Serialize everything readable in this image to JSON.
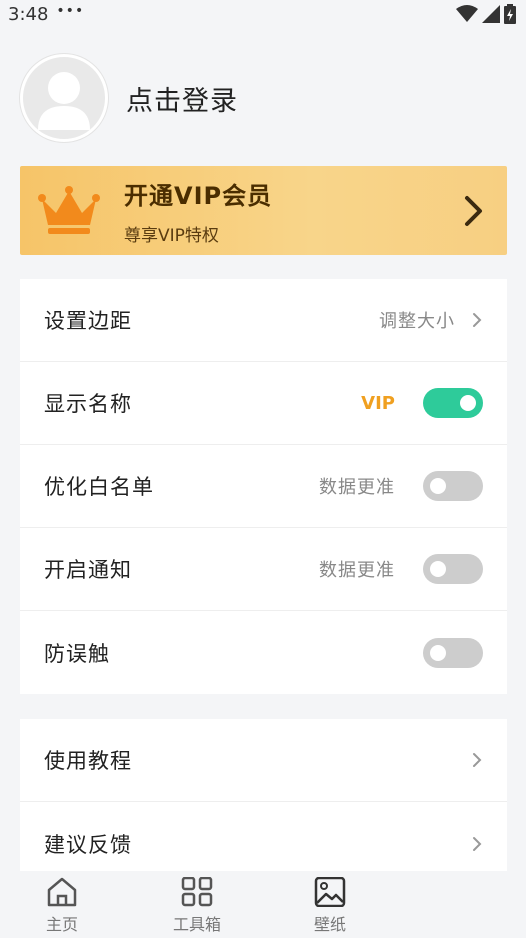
{
  "status_bar": {
    "time": "3:48",
    "dots": "•••",
    "icons": [
      "wifi-icon",
      "signal-icon",
      "battery-charging-icon"
    ]
  },
  "profile": {
    "login_text": "点击登录",
    "avatar_icon": "user-avatar-icon"
  },
  "vip_banner": {
    "title": "开通VIP会员",
    "subtitle": "尊享VIP特权",
    "icon": "crown-icon"
  },
  "settings": [
    {
      "label": "设置边距",
      "hint": "调整大小",
      "control": "arrow"
    },
    {
      "label": "显示名称",
      "badge": "VIP",
      "control": "toggle",
      "on": true
    },
    {
      "label": "优化白名单",
      "hint": "数据更准",
      "control": "toggle",
      "on": false
    },
    {
      "label": "开启通知",
      "hint": "数据更准",
      "control": "toggle",
      "on": false
    },
    {
      "label": "防误触",
      "control": "toggle",
      "on": false
    }
  ],
  "links": [
    {
      "label": "使用教程"
    },
    {
      "label": "建议反馈"
    }
  ],
  "bottom_nav": [
    {
      "label": "主页",
      "icon": "home-icon"
    },
    {
      "label": "工具箱",
      "icon": "grid-icon"
    },
    {
      "label": "壁纸",
      "icon": "image-icon"
    }
  ],
  "colors": {
    "toggle_on": "#2ecb9a",
    "toggle_off": "#cdcdcd",
    "vip_accent": "#f0a020",
    "vip_banner": "#f6c468"
  }
}
